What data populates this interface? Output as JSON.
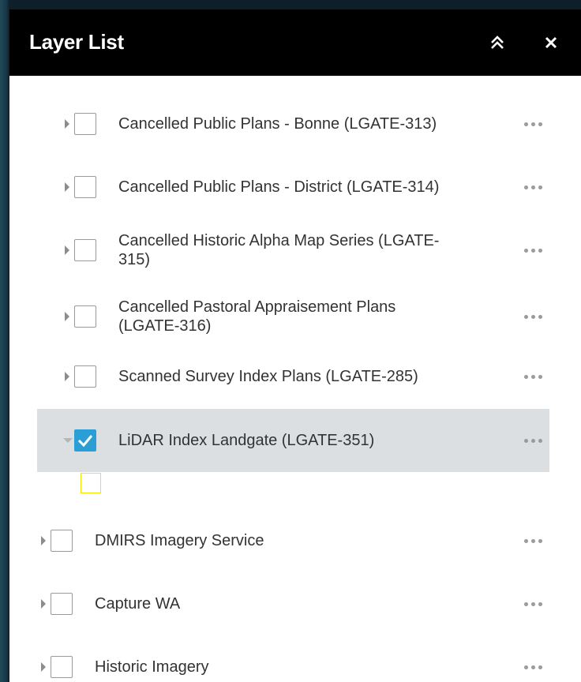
{
  "header": {
    "title": "Layer List",
    "collapse_icon": "double-chevron-up-icon",
    "close_icon": "close-icon"
  },
  "layers": [
    {
      "label_lines": [
        "Cancelled Public Plans - Bonne (LGATE-313)"
      ],
      "checked": false,
      "expanded": false,
      "selected": false
    },
    {
      "label_lines": [
        "Cancelled Public Plans - District (LGATE-314)"
      ],
      "checked": false,
      "expanded": false,
      "selected": false
    },
    {
      "label_lines": [
        "Cancelled Historic Alpha Map Series (LGATE-",
        "315)"
      ],
      "checked": false,
      "expanded": false,
      "selected": false
    },
    {
      "label_lines": [
        "Cancelled Pastoral Appraisement Plans",
        "(LGATE-316)"
      ],
      "checked": false,
      "expanded": false,
      "selected": false
    },
    {
      "label_lines": [
        "Scanned Survey Index Plans (LGATE-285)"
      ],
      "checked": false,
      "expanded": false,
      "selected": false
    },
    {
      "label_lines": [
        "LiDAR Index Landgate (LGATE-351)"
      ],
      "checked": true,
      "expanded": true,
      "selected": true
    },
    {
      "label_lines": [
        "DMIRS Imagery Service"
      ],
      "checked": false,
      "expanded": false,
      "selected": false
    },
    {
      "label_lines": [
        "Capture WA"
      ],
      "checked": false,
      "expanded": false,
      "selected": false
    },
    {
      "label_lines": [
        "Historic Imagery"
      ],
      "checked": false,
      "expanded": false,
      "selected": false
    }
  ],
  "colors": {
    "header_bg": "#000000",
    "checked": "#2a9fd6",
    "selected_row": "#dcdfe2",
    "legend_outline": "#f2e600"
  }
}
